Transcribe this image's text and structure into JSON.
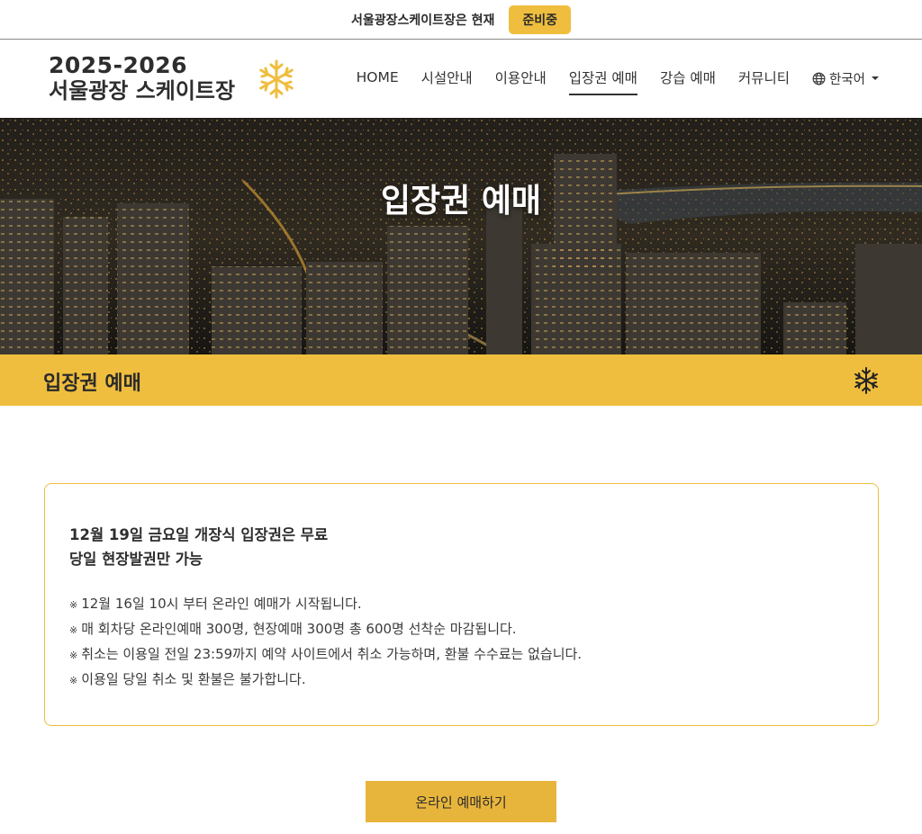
{
  "status_bar": {
    "text": "서울광장스케이트장은 현재",
    "badge": "준비중"
  },
  "logo": {
    "year": "2025-2026",
    "name": "서울광장 스케이트장"
  },
  "nav": {
    "items": [
      {
        "label": "HOME",
        "active": false
      },
      {
        "label": "시설안내",
        "active": false
      },
      {
        "label": "이용안내",
        "active": false
      },
      {
        "label": "입장권 예매",
        "active": true
      },
      {
        "label": "강습 예매",
        "active": false
      },
      {
        "label": "커뮤니티",
        "active": false
      }
    ],
    "language": "한국어"
  },
  "hero": {
    "title": "입장권 예매"
  },
  "section": {
    "title": "입장권 예매"
  },
  "notice": {
    "headline_lines": [
      "12월 19일 금요일 개장식 입장권은 무료",
      "당일 현장발권만 가능"
    ],
    "items": [
      "12월 16일 10시 부터 온라인 예매가 시작됩니다.",
      "매 회차당 온라인예매 300명, 현장예매 300명 총 600명 선착순 마감됩니다.",
      "취소는 이용일 전일 23:59까지 예약 사이트에서 취소 가능하며, 환불 수수료는 없습니다.",
      "이용일 당일 취소 및 환불은 불가합니다."
    ]
  },
  "reserve_button": {
    "label": "온라인 예매하기"
  },
  "colors": {
    "accent": "#efbe3e",
    "button": "#e8b53c",
    "text": "#2b2b2b"
  }
}
